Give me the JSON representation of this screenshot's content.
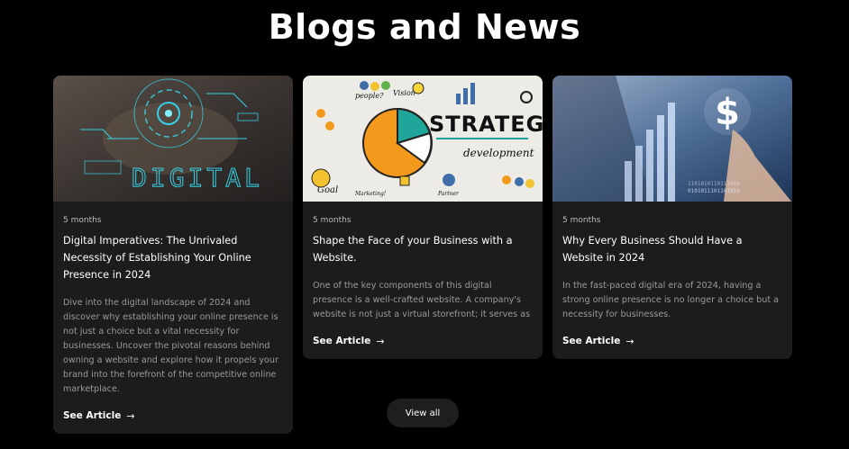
{
  "section": {
    "title": "Blogs and News"
  },
  "cards": [
    {
      "date": "5 months",
      "title": "Digital Imperatives: The Unrivaled Necessity of Establishing Your Online Presence in 2024",
      "excerpt": "Dive into the digital landscape of 2024 and discover why establishing your online presence is not just a choice but a vital necessity for businesses. Uncover the pivotal reasons behind owning a website and explore how it propels your brand into the forefront of the competitive online marketplace.",
      "link_label": "See Article",
      "image_text": "DIGITAL"
    },
    {
      "date": "5 months",
      "title": "Shape the Face of your Business with a Website.",
      "excerpt": "One of the key components of this digital presence is a well-crafted website. A company's website is not just a virtual storefront; it serves as a powerful tool that can significantly impact its overall image",
      "link_label": "See Article",
      "image_text": {
        "strategy": "STRATEGY",
        "development": "development",
        "people": "people?",
        "vision": "Vision",
        "goal": "Goal",
        "marketing": "Marketing!",
        "partner": "Partner"
      }
    },
    {
      "date": "5 months",
      "title": "Why Every Business Should Have a Website in 2024",
      "excerpt": "In the fast-paced digital era of 2024, having a strong online presence is no longer a choice but a necessity for businesses.",
      "link_label": "See Article",
      "image_text": "$"
    }
  ],
  "view_all": {
    "label": "View all"
  },
  "colors": {
    "background": "#000000",
    "card": "#1c1c1c",
    "accent_cyan": "#36d0e6",
    "strategy_orange": "#f39a1d",
    "strategy_teal": "#1fa59a"
  }
}
